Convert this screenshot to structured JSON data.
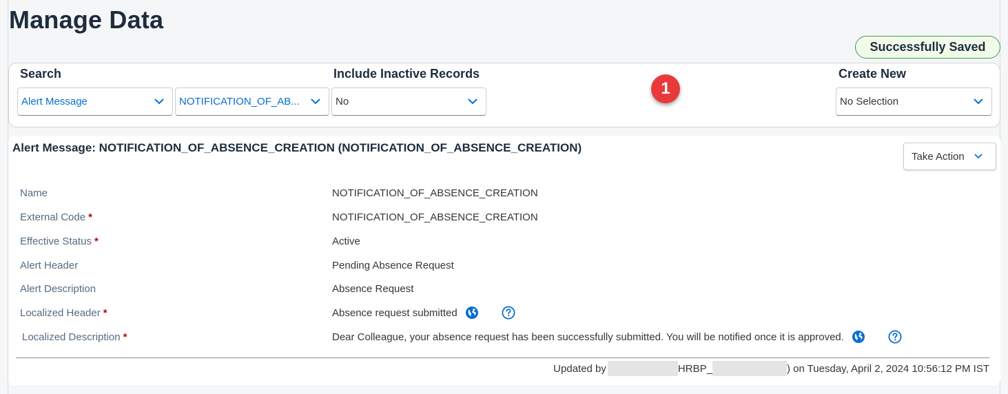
{
  "page": {
    "title": "Manage Data",
    "status_badge": "Successfully Saved",
    "step_marker": "1"
  },
  "search": {
    "search_label": "Search",
    "object_type": "Alert Message",
    "object_instance": "NOTIFICATION_OF_AB...",
    "inactive_label": "Include Inactive Records",
    "inactive_value": "No",
    "create_label": "Create New",
    "create_value": "No Selection"
  },
  "record": {
    "title": "Alert Message: NOTIFICATION_OF_ABSENCE_CREATION (NOTIFICATION_OF_ABSENCE_CREATION)",
    "take_action_label": "Take Action",
    "fields": [
      {
        "label": "Name",
        "required": "",
        "value": "NOTIFICATION_OF_ABSENCE_CREATION"
      },
      {
        "label": "External Code",
        "required": "*",
        "value": "NOTIFICATION_OF_ABSENCE_CREATION"
      },
      {
        "label": "Effective Status",
        "required": "*",
        "value": "Active"
      },
      {
        "label": "Alert Header",
        "required": "",
        "value": "Pending Absence Request"
      },
      {
        "label": "Alert Description",
        "required": "",
        "value": "Absence Request"
      },
      {
        "label": "Localized Header",
        "required": "*",
        "value": "Absence request submitted"
      },
      {
        "label": "Localized Description",
        "required": "*",
        "value": "Dear Colleague, your absence request has been successfully submitted. You will be notified once it is approved."
      }
    ],
    "updated": {
      "prefix": "Updated by",
      "mid": "HRBP_",
      "suffix": ") on Tuesday, April 2, 2024 10:56:12 PM IST"
    }
  },
  "icons": {
    "globe": "globe-icon",
    "help": "help-icon",
    "chevron": "chevron-down-icon"
  },
  "colors": {
    "accent": "#0a6ed1",
    "success_border": "#3e9b4d",
    "required": "#bb0000",
    "marker": "#e83a3a"
  }
}
